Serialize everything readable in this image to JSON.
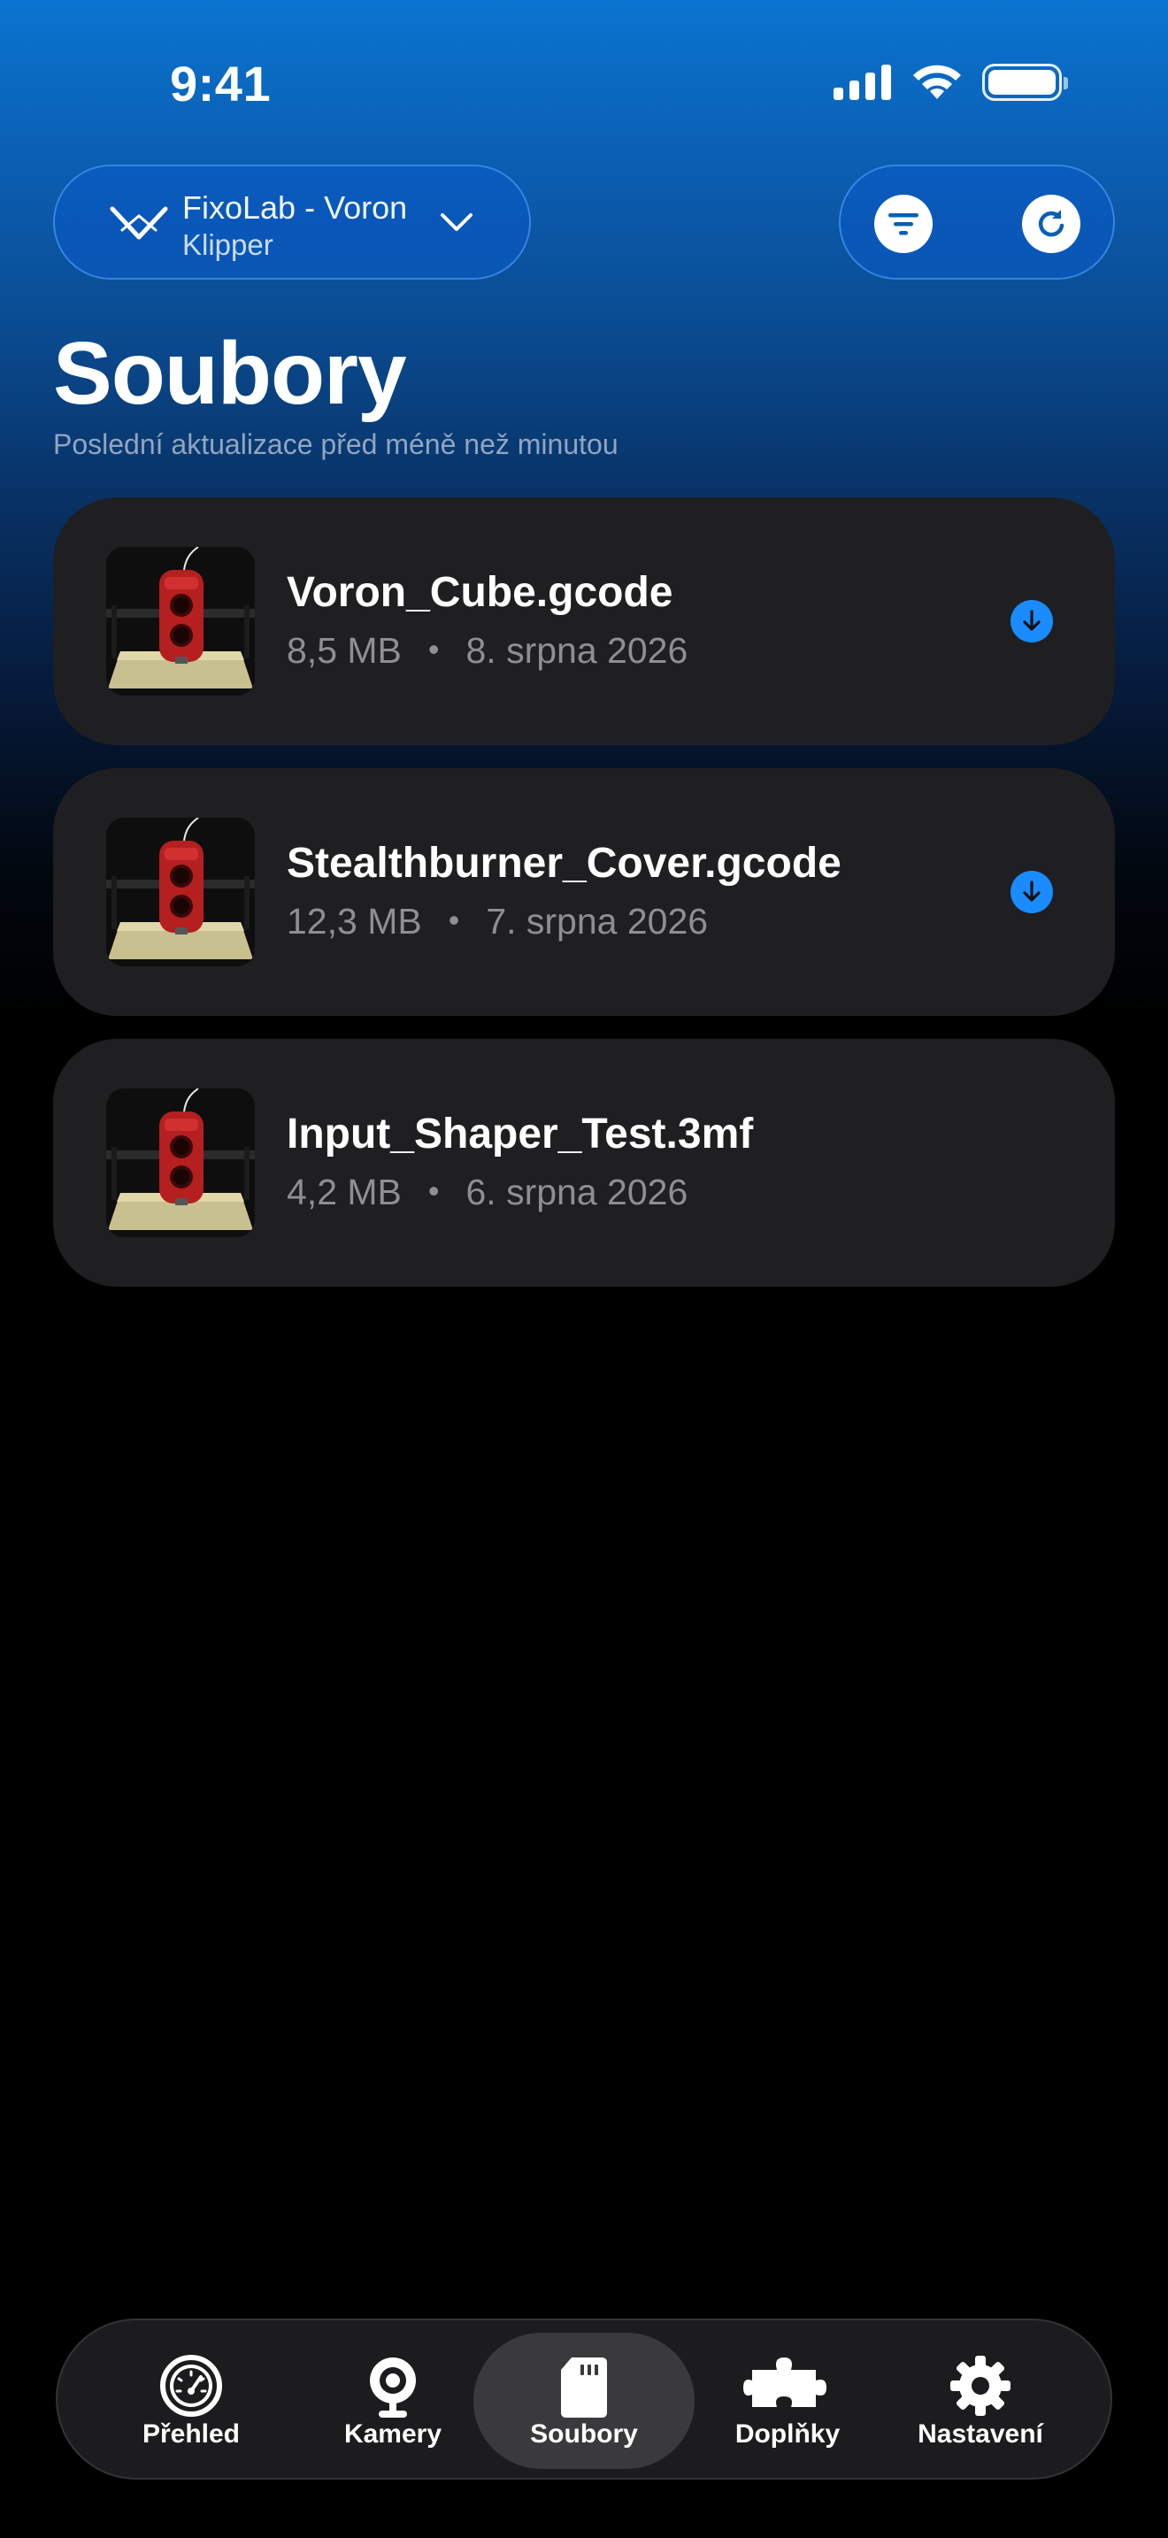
{
  "status_bar": {
    "time": "9:41"
  },
  "printer": {
    "name": "FixoLab - Voron",
    "type": "Klipper"
  },
  "header": {
    "title": "Soubory",
    "subtitle": "Poslední aktualizace před méně než minutou"
  },
  "files": [
    {
      "name": "Voron_Cube.gcode",
      "size": "8,5 MB",
      "date": "8. srpna 2026",
      "downloaded": true
    },
    {
      "name": "Stealthburner_Cover.gcode",
      "size": "12,3 MB",
      "date": "7. srpna 2026",
      "downloaded": true
    },
    {
      "name": "Input_Shaper_Test.3mf",
      "size": "4,2 MB",
      "date": "6. srpna 2026",
      "downloaded": false
    }
  ],
  "meta_separator": "•",
  "tab_bar": {
    "active": "Soubory",
    "tabs": [
      {
        "label": "Přehled",
        "icon": "gauge-icon"
      },
      {
        "label": "Kamery",
        "icon": "webcam-icon"
      },
      {
        "label": "Soubory",
        "icon": "sd-card-icon"
      },
      {
        "label": "Doplňky",
        "icon": "puzzle-icon"
      },
      {
        "label": "Nastavení",
        "icon": "gear-icon"
      }
    ]
  },
  "colors": {
    "accent": "#1a8cff",
    "card_background": "#1f1f22",
    "header_gradient_top": "#0a74d0",
    "background": "#000000",
    "secondary_text": "#8e8e93"
  }
}
